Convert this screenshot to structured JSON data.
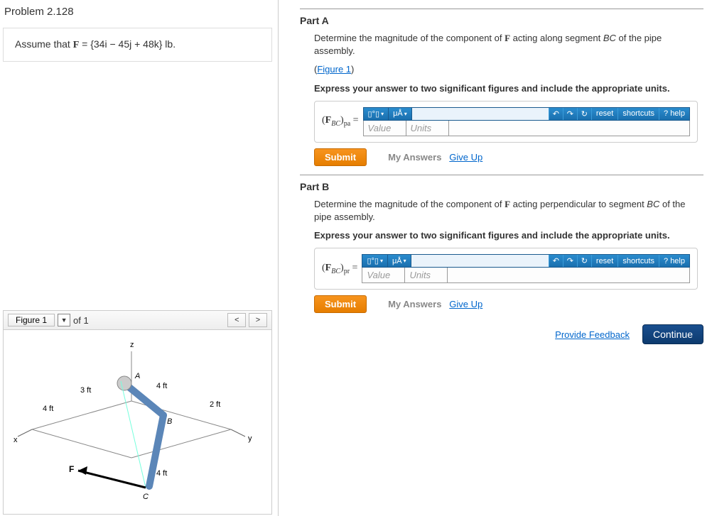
{
  "problem": {
    "title": "Problem 2.128",
    "assume_prefix": "Assume that ",
    "assume_F": "F",
    "assume_eq": " = {34i − 45j + 48k} lb."
  },
  "figure": {
    "label": "Figure 1",
    "of_text": "of 1",
    "prev": "<",
    "next": ">",
    "labels": {
      "x": "x",
      "y": "y",
      "z": "z",
      "A": "A",
      "B": "B",
      "C": "C",
      "F": "F",
      "d3": "3 ft",
      "d4a": "4 ft",
      "d4b": "4 ft",
      "d4c": "4 ft",
      "d2": "2 ft"
    }
  },
  "partA": {
    "title": "Part A",
    "q1a": "Determine the magnitude of the component of ",
    "q1b": " acting along segment ",
    "seg": "BC",
    "q1c": " of the pipe assembly.",
    "figlink": "Figure 1",
    "instr": "Express your answer to two significant figures and include the appropriate units.",
    "lhs_open": "(",
    "lhs_F": "F",
    "lhs_sub": "BC",
    "lhs_close": ")",
    "lhs_sub2": "pa",
    "lhs_eq": " =",
    "value_ph": "Value",
    "units_ph": "Units",
    "submit": "Submit",
    "myans": "My Answers",
    "giveup": "Give Up"
  },
  "partB": {
    "title": "Part B",
    "q1a": "Determine the magnitude of the component of ",
    "q1b": " acting perpendicular to segment ",
    "seg": "BC",
    "q1c": " of the pipe assembly.",
    "instr": "Express your answer to two significant figures and include the appropriate units.",
    "lhs_open": "(",
    "lhs_F": "F",
    "lhs_sub": "BC",
    "lhs_close": ")",
    "lhs_sub2": "pr",
    "lhs_eq": " =",
    "value_ph": "Value",
    "units_ph": "Units",
    "submit": "Submit",
    "myans": "My Answers",
    "giveup": "Give Up"
  },
  "toolbar": {
    "tmpl": "▯°▯",
    "ua": "μÅ",
    "dd": "▾",
    "undo": "↶",
    "redo": "↷",
    "refresh": "↻",
    "reset": "reset",
    "shortcuts": "shortcuts",
    "help": "? help"
  },
  "footer": {
    "feedback": "Provide Feedback",
    "continue": "Continue"
  }
}
